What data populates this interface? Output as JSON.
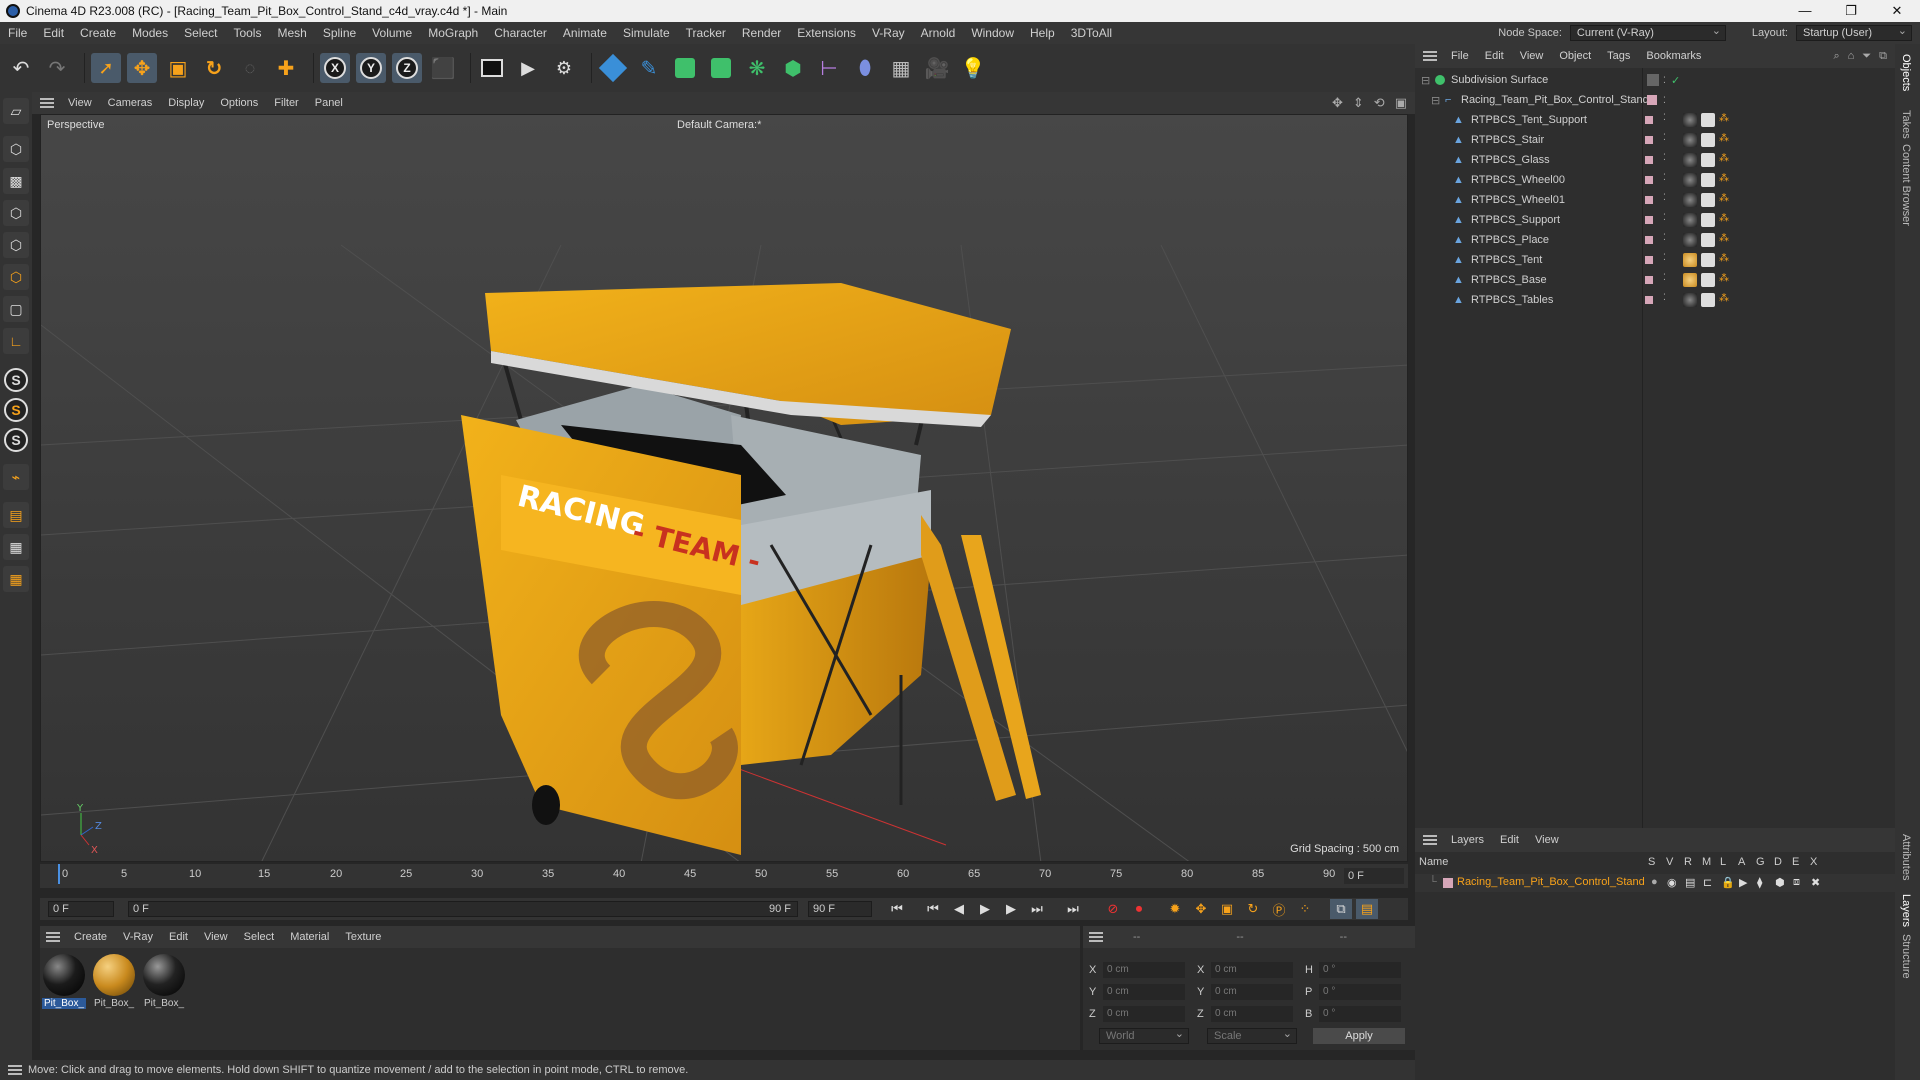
{
  "window": {
    "title": "Cinema 4D R23.008 (RC) - [Racing_Team_Pit_Box_Control_Stand_c4d_vray.c4d *] - Main",
    "buttons": [
      "—",
      "❐",
      "✕"
    ]
  },
  "menubar": {
    "items": [
      "File",
      "Edit",
      "Create",
      "Modes",
      "Select",
      "Tools",
      "Mesh",
      "Spline",
      "Volume",
      "MoGraph",
      "Character",
      "Animate",
      "Simulate",
      "Tracker",
      "Render",
      "Extensions",
      "V-Ray",
      "Arnold",
      "Window",
      "Help",
      "3DToAll"
    ],
    "node_space_label": "Node Space:",
    "node_space_value": "Current (V-Ray)",
    "layout_label": "Layout:",
    "layout_value": "Startup (User)"
  },
  "toolbar": {
    "axis_x": "X",
    "axis_y": "Y",
    "axis_z": "Z"
  },
  "leftstrip": {
    "s_labels": [
      "S",
      "S",
      "S"
    ]
  },
  "viewport": {
    "menu": [
      "View",
      "Cameras",
      "Display",
      "Options",
      "Filter",
      "Panel"
    ],
    "projection": "Perspective",
    "camera": "Default Camera",
    "camera_suffix": ":*",
    "grid_spacing": "Grid Spacing : 500 cm",
    "model_text_1": "RACING",
    "model_text_2": "- TEAM -",
    "axis_y": "Y",
    "axis_z": "Z",
    "axis_x": "X"
  },
  "timeline": {
    "ticks": [
      "0",
      "5",
      "10",
      "15",
      "20",
      "25",
      "30",
      "35",
      "40",
      "45",
      "50",
      "55",
      "60",
      "65",
      "70",
      "75",
      "80",
      "85",
      "90"
    ],
    "current_frame": "0 F"
  },
  "playback": {
    "start": "0 F",
    "range_start": "0 F",
    "range_end": "90 F",
    "end": "90 F"
  },
  "material_manager": {
    "menu": [
      "Create",
      "V-Ray",
      "Edit",
      "View",
      "Select",
      "Material",
      "Texture"
    ],
    "materials": [
      {
        "label": "Pit_Box_",
        "color": "#1b1b1b",
        "selected": true
      },
      {
        "label": "Pit_Box_",
        "color": "#c98a1e",
        "selected": false
      },
      {
        "label": "Pit_Box_",
        "color": "#222222",
        "selected": false
      }
    ]
  },
  "coordinates": {
    "header_dashes": [
      "--",
      "--",
      "--"
    ],
    "rows": [
      {
        "a": "X",
        "av": "0 cm",
        "b": "X",
        "bv": "0 cm",
        "c": "H",
        "cv": "0 °"
      },
      {
        "a": "Y",
        "av": "0 cm",
        "b": "Y",
        "bv": "0 cm",
        "c": "P",
        "cv": "0 °"
      },
      {
        "a": "Z",
        "av": "0 cm",
        "b": "Z",
        "bv": "0 cm",
        "c": "B",
        "cv": "0 °"
      }
    ],
    "mode": "World",
    "transform": "Scale",
    "apply": "Apply"
  },
  "statusbar": {
    "text": "Move: Click and drag to move elements. Hold down SHIFT to quantize movement / add to the selection in point mode, CTRL to remove."
  },
  "object_manager": {
    "menu": [
      "File",
      "Edit",
      "View",
      "Object",
      "Tags",
      "Bookmarks"
    ],
    "root": "Subdivision Surface",
    "group": "Racing_Team_Pit_Box_Control_Stand",
    "children": [
      {
        "name": "RTPBCS_Tent_Support",
        "mat": "#1b1b1b"
      },
      {
        "name": "RTPBCS_Stair",
        "mat": "#1b1b1b"
      },
      {
        "name": "RTPBCS_Glass",
        "mat": "#1b1b1b"
      },
      {
        "name": "RTPBCS_Wheel00",
        "mat": "#1b1b1b"
      },
      {
        "name": "RTPBCS_Wheel01",
        "mat": "#1b1b1b"
      },
      {
        "name": "RTPBCS_Support",
        "mat": "#1b1b1b"
      },
      {
        "name": "RTPBCS_Place",
        "mat": "#1b1b1b"
      },
      {
        "name": "RTPBCS_Tent",
        "mat": "#c98a1e"
      },
      {
        "name": "RTPBCS_Base",
        "mat": "#c98a1e"
      },
      {
        "name": "RTPBCS_Tables",
        "mat": "#1b1b1b"
      }
    ]
  },
  "layers": {
    "menu": [
      "Layers",
      "Edit",
      "View"
    ],
    "name_col": "Name",
    "flag_cols": [
      "S",
      "V",
      "R",
      "M",
      "L",
      "A",
      "G",
      "D",
      "E",
      "X"
    ],
    "layer_name": "Racing_Team_Pit_Box_Control_Stand"
  },
  "vertical_tabs": [
    "Objects",
    "Takes",
    "Content Browser",
    "Attributes",
    "Layers",
    "Structure"
  ]
}
